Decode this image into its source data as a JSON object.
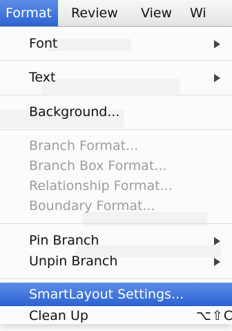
{
  "menubar": {
    "items": [
      {
        "label": "Format",
        "active": true
      },
      {
        "label": "Review"
      },
      {
        "label": "View"
      },
      {
        "label": "Wi"
      }
    ]
  },
  "format_menu": {
    "items": [
      {
        "label": "Font",
        "submenu": true
      },
      {
        "label": "Text",
        "submenu": true
      },
      {
        "label": "Background..."
      },
      {
        "label": "Branch Format...",
        "disabled": true
      },
      {
        "label": "Branch Box Format...",
        "disabled": true
      },
      {
        "label": "Relationship Format...",
        "disabled": true
      },
      {
        "label": "Boundary Format...",
        "disabled": true
      },
      {
        "label": "Pin Branch",
        "submenu": true
      },
      {
        "label": "Unpin Branch",
        "submenu": true
      },
      {
        "label": "SmartLayout Settings...",
        "highlighted": true
      },
      {
        "label": "Clean Up",
        "shortcut": "⌥⇧C"
      }
    ]
  },
  "colors": {
    "highlight": "#2f64d2",
    "disabled_text": "#9d9d9d"
  }
}
